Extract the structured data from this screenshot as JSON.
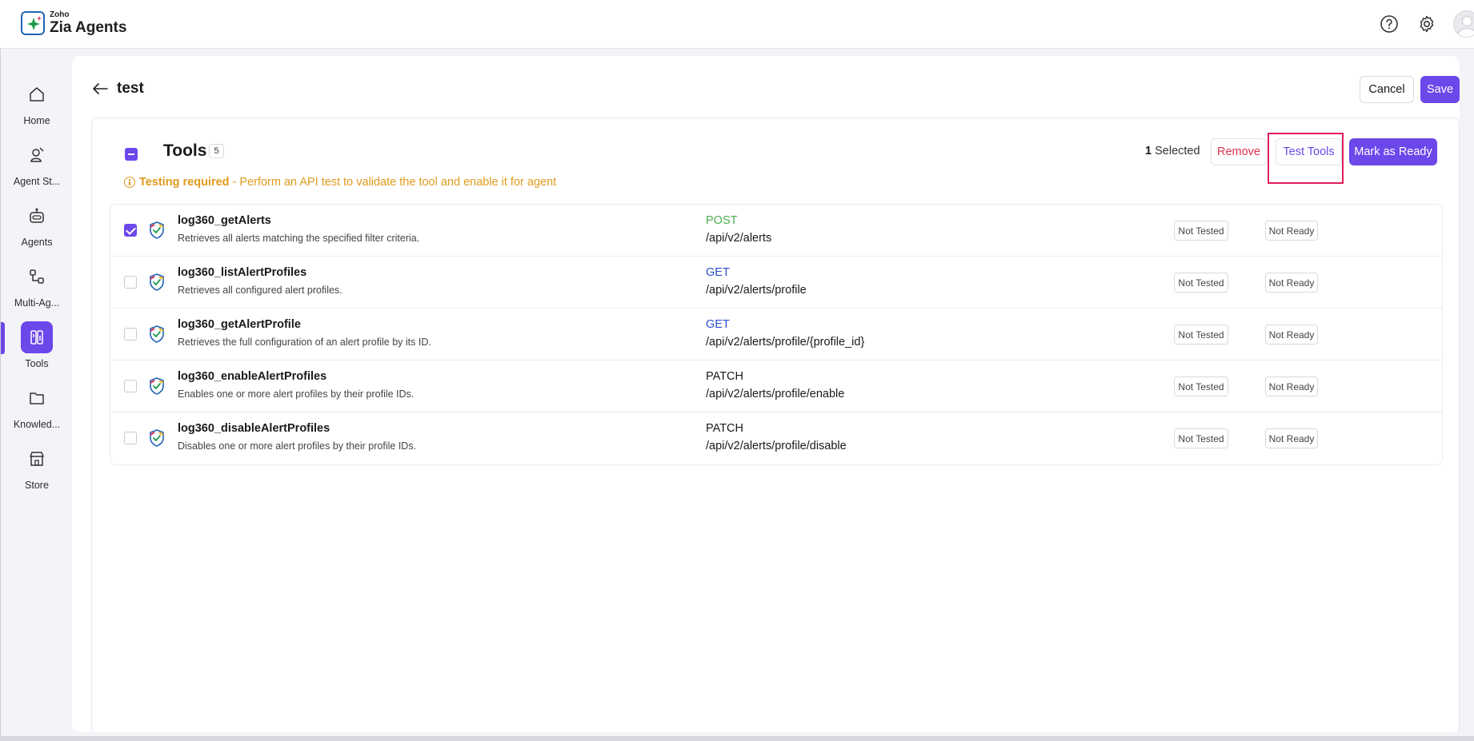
{
  "header": {
    "brand_small": "Zoho",
    "brand_name": "Zia Agents",
    "help_icon": "help-circle-icon",
    "settings_icon": "gear-icon",
    "avatar_icon": "user-avatar-icon"
  },
  "sidebar": {
    "items": [
      {
        "label": "Home",
        "icon": "home-icon",
        "active": false
      },
      {
        "label": "Agent St...",
        "icon": "agent-studio-icon",
        "active": false
      },
      {
        "label": "Agents",
        "icon": "robot-icon",
        "active": false
      },
      {
        "label": "Multi-Ag...",
        "icon": "multi-agent-icon",
        "active": false
      },
      {
        "label": "Tools",
        "icon": "tools-icon",
        "active": true
      },
      {
        "label": "Knowled...",
        "icon": "folder-icon",
        "active": false
      },
      {
        "label": "Store",
        "icon": "store-icon",
        "active": false
      }
    ]
  },
  "page": {
    "title": "test",
    "cancel_label": "Cancel",
    "save_label": "Save"
  },
  "tools": {
    "title": "Tools",
    "count": "5",
    "selected_count": "1",
    "selected_label": "Selected",
    "remove_label": "Remove",
    "test_label": "Test Tools",
    "mark_ready_label": "Mark as Ready",
    "notice_bold": "Testing required",
    "notice_text": "- Perform an API test to validate the tool and enable it for agent",
    "rows": [
      {
        "name": "log360_getAlerts",
        "description": "Retrieves all alerts matching the specified filter criteria.",
        "method": "POST",
        "path": "/api/v2/alerts",
        "test_status": "Not Tested",
        "ready_status": "Not Ready",
        "checked": true
      },
      {
        "name": "log360_listAlertProfiles",
        "description": "Retrieves all configured alert profiles.",
        "method": "GET",
        "path": "/api/v2/alerts/profile",
        "test_status": "Not Tested",
        "ready_status": "Not Ready",
        "checked": false
      },
      {
        "name": "log360_getAlertProfile",
        "description": "Retrieves the full configuration of an alert profile by its ID.",
        "method": "GET",
        "path": "/api/v2/alerts/profile/{profile_id}",
        "test_status": "Not Tested",
        "ready_status": "Not Ready",
        "checked": false
      },
      {
        "name": "log360_enableAlertProfiles",
        "description": "Enables one or more alert profiles by their profile IDs.",
        "method": "PATCH",
        "path": "/api/v2/alerts/profile/enable",
        "test_status": "Not Tested",
        "ready_status": "Not Ready",
        "checked": false
      },
      {
        "name": "log360_disableAlertProfiles",
        "description": "Disables one or more alert profiles by their profile IDs.",
        "method": "PATCH",
        "path": "/api/v2/alerts/profile/disable",
        "test_status": "Not Tested",
        "ready_status": "Not Ready",
        "checked": false
      }
    ]
  },
  "colors": {
    "accent": "#6c47ea",
    "remove": "#e0304e",
    "warning": "#e09a1c",
    "post": "#4caf50",
    "get": "#2a4fd0",
    "highlight": "#e01e5a"
  }
}
